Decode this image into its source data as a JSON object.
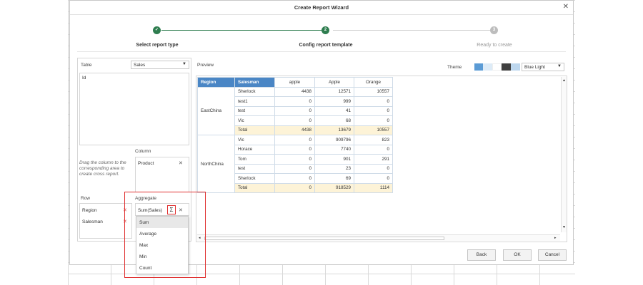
{
  "dialog": {
    "title": "Create Report Wizard",
    "close_glyph": "✕"
  },
  "steps": [
    {
      "label": "Select report type",
      "marker": "✓",
      "state": "done"
    },
    {
      "label": "Config report template",
      "marker": "2",
      "state": "active"
    },
    {
      "label": "Ready to create",
      "marker": "3",
      "state": "pending"
    }
  ],
  "left": {
    "table_label": "Table",
    "table_value": "Sales",
    "fields": [
      "Id"
    ],
    "hint": "Drag the column to the corresponding area to create cross report.",
    "column_label": "Column",
    "column_field": "Product",
    "row_label": "Row",
    "row_fields": [
      "Region",
      "Salesman"
    ],
    "aggregate_label": "Aggregate",
    "aggregate_field": "Sum(Sales)",
    "sigma": "Σ",
    "remove_glyph": "✕",
    "red_remove_glyph": "✕"
  },
  "aggregate_menu": [
    "Sum",
    "Average",
    "Max",
    "Min",
    "Count"
  ],
  "preview": {
    "label": "Preview",
    "theme_label": "Theme",
    "theme_value": "Blue Light",
    "theme_swatches": [
      "#5b9bd5",
      "#ddebf7",
      "#ffffff",
      "#404040",
      "#bdd7ee"
    ],
    "headers": [
      "Region",
      "Salesman",
      "apple",
      "Apple",
      "Orange"
    ],
    "groups": [
      {
        "region": "EastChina",
        "rows": [
          [
            "Sherlock",
            "4438",
            "12571",
            "10557"
          ],
          [
            "test1",
            "0",
            "999",
            "0"
          ],
          [
            "test",
            "0",
            "41",
            "0"
          ],
          [
            "Vic",
            "0",
            "68",
            "0"
          ],
          [
            "Total",
            "4438",
            "13679",
            "10557"
          ]
        ]
      },
      {
        "region": "NorthChina",
        "rows": [
          [
            "Vic",
            "0",
            "909796",
            "823"
          ],
          [
            "Horace",
            "0",
            "7740",
            "0"
          ],
          [
            "Tom",
            "0",
            "901",
            "291"
          ],
          [
            "test",
            "0",
            "23",
            "0"
          ],
          [
            "Sherlock",
            "0",
            "69",
            "0"
          ],
          [
            "Total",
            "0",
            "918529",
            "1114"
          ]
        ]
      }
    ]
  },
  "buttons": {
    "back": "Back",
    "ok": "OK",
    "cancel": "Cancel"
  },
  "colors": {
    "done": "#2e7d4f",
    "accent": "#4a86c5",
    "highlight": "#e03030"
  }
}
